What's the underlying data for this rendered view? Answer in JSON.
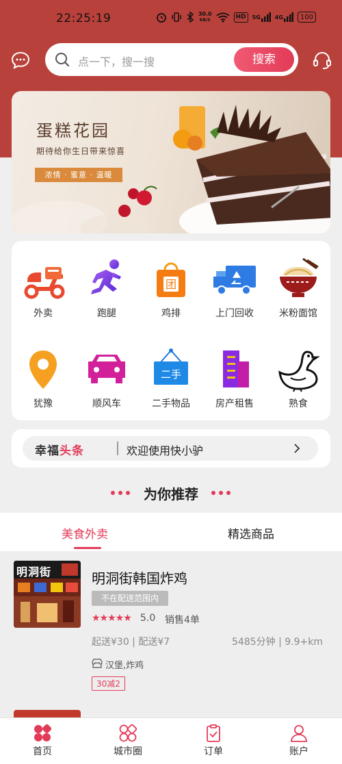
{
  "status_bar": {
    "time": "22:25:19",
    "net_speed_value": "30.0",
    "net_speed_unit": "KB/S",
    "hd_label": "HD",
    "sig1_label": "5G",
    "sig2_label": "4G",
    "battery": "100"
  },
  "header": {
    "search_placeholder": "点一下，搜一搜",
    "search_button": "搜索"
  },
  "banner": {
    "title": "蛋糕花园",
    "subtitle": "期待给你生日带来惊喜",
    "tag": "浓情 · 蜜意 · 温暖"
  },
  "categories": [
    {
      "label": "外卖",
      "icon": "scooter-icon"
    },
    {
      "label": "跑腿",
      "icon": "runner-icon"
    },
    {
      "label": "鸡排",
      "icon": "shopping-bag-icon",
      "icon_text": "团"
    },
    {
      "label": "上门回收",
      "icon": "recycle-truck-icon"
    },
    {
      "label": "米粉面馆",
      "icon": "noodle-bowl-icon"
    },
    {
      "label": "犹豫",
      "icon": "location-pin-icon"
    },
    {
      "label": "顺风车",
      "icon": "car-icon"
    },
    {
      "label": "二手物品",
      "icon": "secondhand-sign-icon",
      "icon_text": "二手"
    },
    {
      "label": "房产租售",
      "icon": "building-icon"
    },
    {
      "label": "熟食",
      "icon": "goose-icon"
    }
  ],
  "news": {
    "logo_part1": "幸福",
    "logo_part2": "头条",
    "text": "欢迎使用快小驴"
  },
  "recommend": {
    "title": "为你推荐"
  },
  "tabs": [
    {
      "label": "美食外卖",
      "active": true
    },
    {
      "label": "精选商品",
      "active": false
    }
  ],
  "shops": [
    {
      "image_text": "明洞街",
      "name": "明洞街韩国炸鸡",
      "status_badge": "不在配送范围内",
      "stars": "★★★★★",
      "rating": "5.0",
      "sales": "销售4单",
      "delivery": "起送¥30 | 配送¥7",
      "distance": "5485分钟 | 9.9+km",
      "category": "汉堡,炸鸡",
      "promo": "30减2"
    }
  ],
  "bottom_nav": [
    {
      "label": "首页",
      "icon": "home-grid-icon",
      "active": true
    },
    {
      "label": "城市圈",
      "icon": "city-circle-icon",
      "active": false
    },
    {
      "label": "订单",
      "icon": "order-clipboard-icon",
      "active": false
    },
    {
      "label": "账户",
      "icon": "user-icon",
      "active": false
    }
  ],
  "colors": {
    "brand_red": "#e23b58",
    "header_bg": "#b9413b"
  }
}
